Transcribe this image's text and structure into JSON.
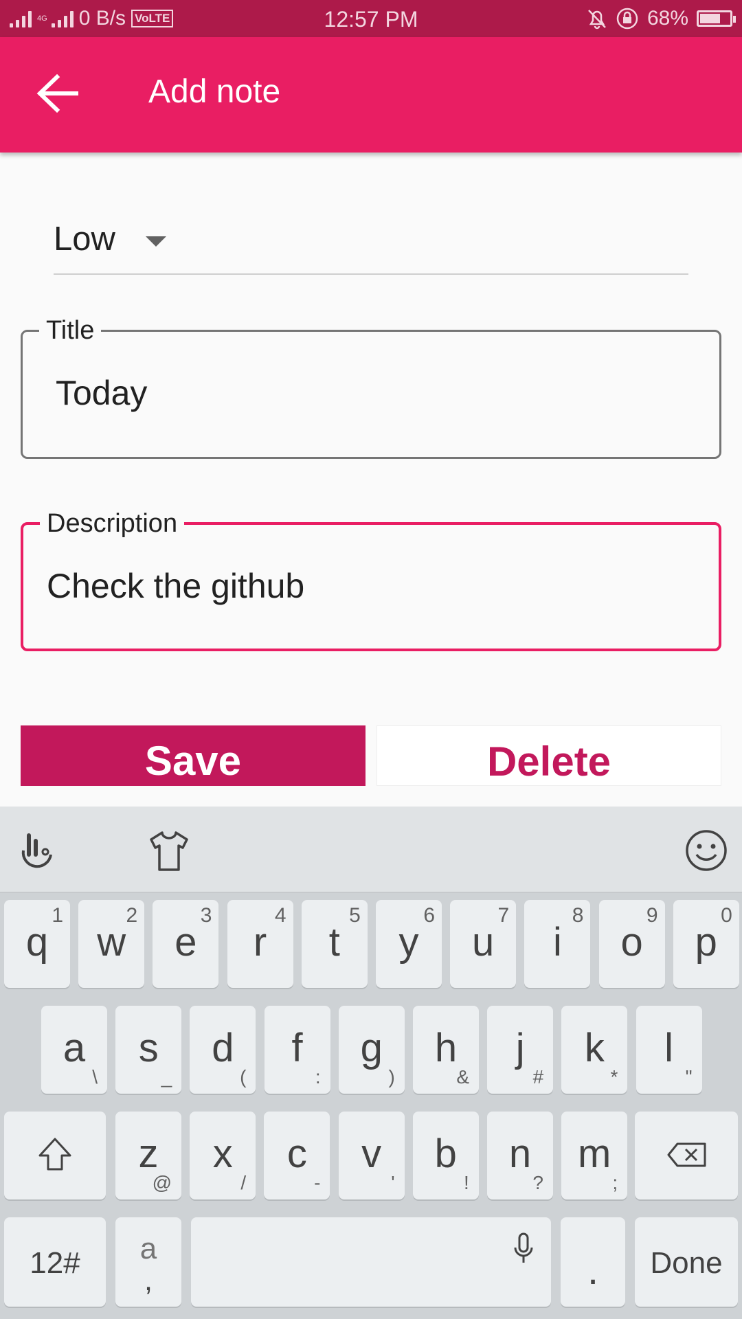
{
  "status_bar": {
    "network_speed": "0 B/s",
    "network_type": "4G",
    "volte": "VoLTE",
    "time": "12:57 PM",
    "battery": "68%"
  },
  "app_bar": {
    "title": "Add note",
    "back_icon": "arrow-back-icon"
  },
  "form": {
    "priority": {
      "selected": "Low"
    },
    "title_field": {
      "label": "Title",
      "value": "Today"
    },
    "description_field": {
      "label": "Description",
      "value": "Check the github"
    },
    "save_label": "Save",
    "delete_label": "Delete"
  },
  "colors": {
    "accent": "#e91e63",
    "status_bar": "#ad1a4a",
    "button": "#c2185b"
  },
  "keyboard": {
    "toolbar_icons": [
      "swipe-gesture-icon",
      "theme-shirt-icon",
      "emoji-icon"
    ],
    "row1": [
      {
        "k": "q",
        "h": "1"
      },
      {
        "k": "w",
        "h": "2"
      },
      {
        "k": "e",
        "h": "3"
      },
      {
        "k": "r",
        "h": "4"
      },
      {
        "k": "t",
        "h": "5"
      },
      {
        "k": "y",
        "h": "6"
      },
      {
        "k": "u",
        "h": "7"
      },
      {
        "k": "i",
        "h": "8"
      },
      {
        "k": "o",
        "h": "9"
      },
      {
        "k": "p",
        "h": "0"
      }
    ],
    "row2": [
      {
        "k": "a",
        "s": "\\"
      },
      {
        "k": "s",
        "s": "_"
      },
      {
        "k": "d",
        "s": "("
      },
      {
        "k": "f",
        "s": ":"
      },
      {
        "k": "g",
        "s": ")"
      },
      {
        "k": "h",
        "s": "&"
      },
      {
        "k": "j",
        "s": "#"
      },
      {
        "k": "k",
        "s": "*"
      },
      {
        "k": "l",
        "s": "\""
      }
    ],
    "row3": [
      {
        "k": "z",
        "s": "@"
      },
      {
        "k": "x",
        "s": "/"
      },
      {
        "k": "c",
        "s": "-"
      },
      {
        "k": "v",
        "s": "'"
      },
      {
        "k": "b",
        "s": "!"
      },
      {
        "k": "n",
        "s": "?"
      },
      {
        "k": "m",
        "s": ";"
      }
    ],
    "symbols_key": "12#",
    "lang_key_top": "a",
    "lang_key_bottom": ",",
    "period_key": ".",
    "done_key": "Done"
  }
}
